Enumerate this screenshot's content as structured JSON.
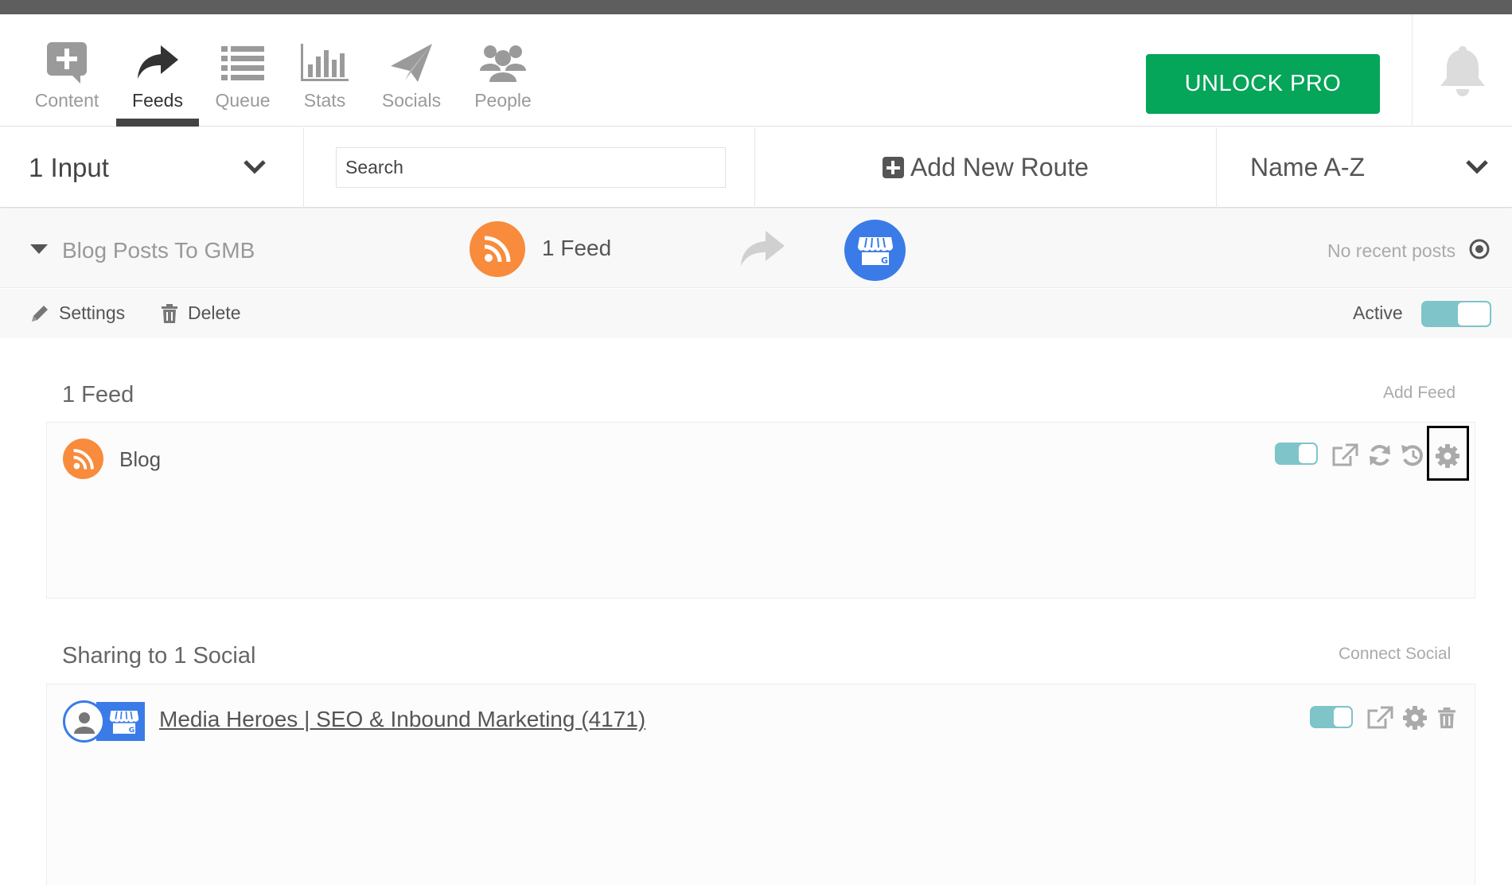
{
  "nav": {
    "items": [
      {
        "id": "content",
        "label": "Content",
        "icon": "plus-chat-icon",
        "active": false
      },
      {
        "id": "feeds",
        "label": "Feeds",
        "icon": "share-arrow-icon",
        "active": true
      },
      {
        "id": "queue",
        "label": "Queue",
        "icon": "list-icon",
        "active": false
      },
      {
        "id": "stats",
        "label": "Stats",
        "icon": "bar-chart-icon",
        "active": false
      },
      {
        "id": "socials",
        "label": "Socials",
        "icon": "paper-plane-icon",
        "active": false
      },
      {
        "id": "people",
        "label": "People",
        "icon": "users-icon",
        "active": false
      }
    ],
    "unlock_label": "UNLOCK PRO",
    "bell_icon": "bell-icon"
  },
  "filters": {
    "input_select": "1 Input",
    "search_placeholder": "Search",
    "add_route_label": "Add New Route",
    "sort_select": "Name A-Z"
  },
  "route": {
    "name": "Blog Posts To GMB",
    "feed_count": "1 Feed",
    "status": "No recent posts",
    "settings_label": "Settings",
    "delete_label": "Delete",
    "active_label": "Active",
    "active": true
  },
  "feeds_section": {
    "title": "1 Feed",
    "add_link": "Add Feed",
    "items": [
      {
        "name": "Blog",
        "enabled": true
      }
    ]
  },
  "socials_section": {
    "title": "Sharing to 1 Social",
    "connect_link": "Connect Social",
    "items": [
      {
        "name": "Media Heroes | SEO & Inbound Marketing (4171)",
        "enabled": true
      }
    ]
  },
  "colors": {
    "accent_green": "#05a55a",
    "rss_orange": "#f88b3c",
    "gmb_blue": "#3a7be8",
    "toggle_teal": "#7fc4c8"
  }
}
